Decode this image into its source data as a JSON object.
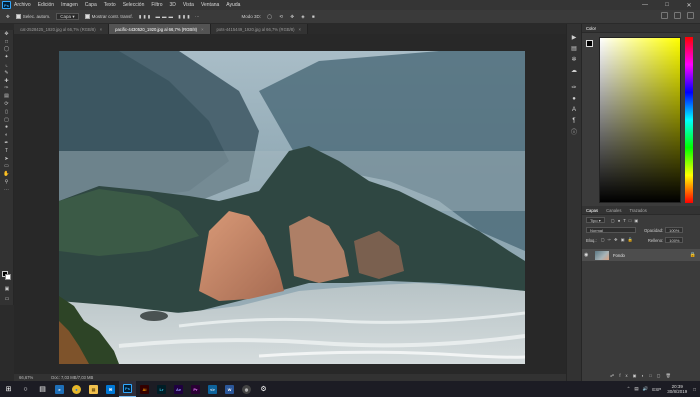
{
  "menu": {
    "logo": "Ps",
    "items": [
      "Archivo",
      "Edición",
      "Imagen",
      "Capa",
      "Texto",
      "Selección",
      "Filtro",
      "3D",
      "Vista",
      "Ventana",
      "Ayuda"
    ]
  },
  "options": {
    "tool_preset": "Selec. autom.",
    "layer_select": "Capa",
    "show_transform": "Mostrar contr. transf.",
    "mode_3d": "Modo 3D:"
  },
  "tabs": [
    {
      "label": "cat-2528425_1920.jpg al 66,7% (RGB/8)",
      "active": false
    },
    {
      "label": "pacific-4430520_1920.jpg al 66,7% (RGB/8)",
      "active": true
    },
    {
      "label": "pots-4415449_1920.jpg al 66,7% (RGB/8)",
      "active": false
    }
  ],
  "status": {
    "zoom": "66,67%",
    "doc": "Doc: 7,03 MB/7,03 MB"
  },
  "color_panel": {
    "title": "Color"
  },
  "layers_panel": {
    "tabs": [
      "Capas",
      "Canales",
      "Trazados"
    ],
    "filter": "Tipo",
    "blend": "Normal",
    "opacity_label": "Opacidad:",
    "opacity": "100%",
    "lock_label": "Bloq.:",
    "fill_label": "Relleno:",
    "fill": "100%",
    "layer_name": "Fondo"
  },
  "taskbar": {
    "time": "20:39",
    "date": "30/8/2019",
    "lang": "ESP"
  },
  "colors": {
    "accent": "#31a8ff",
    "panel": "#3b3b3b",
    "taskbar": "#1c1c24"
  }
}
